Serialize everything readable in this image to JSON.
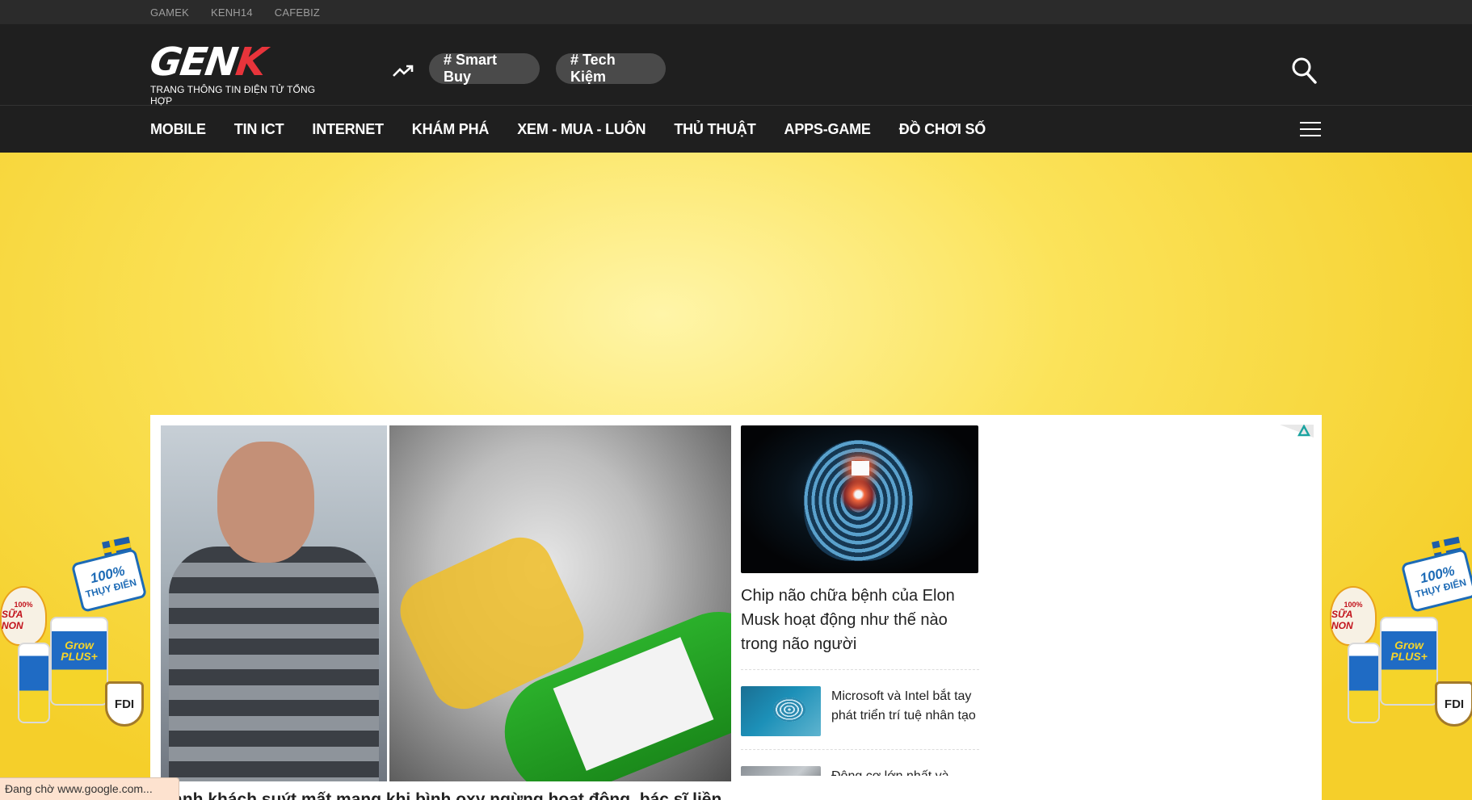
{
  "topbar": {
    "links": [
      "GAMEK",
      "KENH14",
      "CAFEBIZ"
    ]
  },
  "header": {
    "logo_text": "GENK",
    "tagline": "TRANG THÔNG TIN ĐIỆN TỬ TỔNG HỢP",
    "trending_icon": "trending-up-icon",
    "tags": [
      "# Smart Buy",
      "# Tech Kiệm"
    ],
    "search_icon": "search-icon"
  },
  "nav": {
    "items": [
      "MOBILE",
      "TIN ICT",
      "INTERNET",
      "KHÁM PHÁ",
      "XEM - MUA - LUÔN",
      "THỦ THUẬT",
      "APPS-GAME",
      "ĐỒ CHƠI SỐ"
    ],
    "menu_icon": "hamburger-menu-icon"
  },
  "background_ad": {
    "badge_top": "100%",
    "badge_main": "SỮA NON",
    "sweden_main": "100%",
    "sweden_sub": "THỤY ĐIỂN",
    "product_name": "Grow PLUS+",
    "fdi": "FDI",
    "accent_color": "#f5d636"
  },
  "featured": {
    "hero_title": "Hành khách suýt mất mạng khi bình oxy ngừng hoạt động, bác sĩ liền chế tạo máy thở từ bình nước",
    "side_main": {
      "title": "Chip não chữa bệnh của Elon Musk hoạt động như thế nào trong não người"
    },
    "side_list": [
      {
        "title": "Microsoft và Intel bắt tay phát triển trí tuệ nhân tạo"
      },
      {
        "title": "Động cơ lớn nhất và"
      }
    ],
    "adchoices_icon": "adchoices-icon"
  },
  "status": {
    "text": "Đang chờ www.google.com..."
  },
  "colors": {
    "header_bg": "#1f1f1f",
    "topbar_bg": "#2b2b2b",
    "pill_bg": "#4a4a4a",
    "logo_accent": "#e8343b"
  }
}
